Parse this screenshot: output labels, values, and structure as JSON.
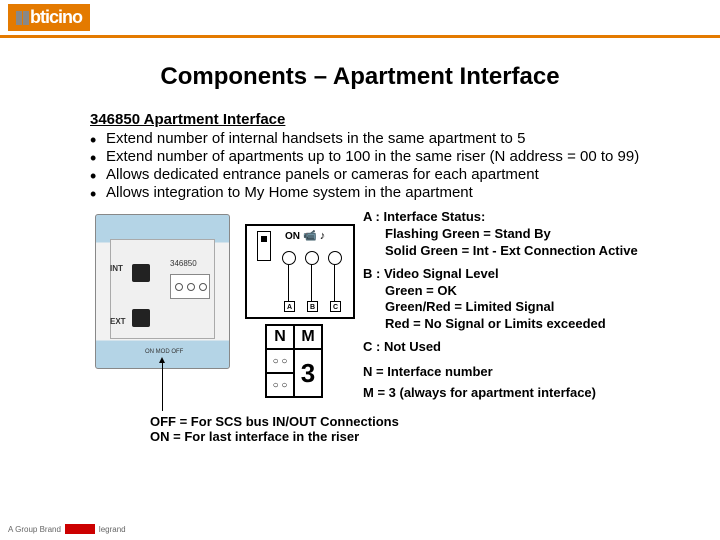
{
  "header": {
    "brand": "bticino"
  },
  "title": "Components – Apartment Interface",
  "subtitle": "346850 Apartment Interface",
  "bullets": [
    "Extend number of internal handsets in the same apartment to 5",
    "Extend number of apartments up to 100 in the same riser (N address = 00 to 99)",
    "Allows dedicated entrance panels or cameras for each apartment",
    "Allows integration to My Home system in the apartment"
  ],
  "device": {
    "model": "346850",
    "int": "INT",
    "ext": "EXT",
    "switch": "ON  MOD  OFF"
  },
  "schematic": {
    "on": "ON",
    "icons": "📹 ♪",
    "a": "A",
    "b": "B",
    "c": "C",
    "n": "N",
    "m": "M",
    "three": "3"
  },
  "legend": {
    "a_label": "A :  Interface Status:",
    "a_line1": "Flashing Green = Stand By",
    "a_line2": "Solid Green       = Int - Ext Connection Active",
    "b_label": "B :  Video Signal Level",
    "b_line1": "Green           = OK",
    "b_line2": "Green/Red = Limited Signal",
    "b_line3": "Red              = No Signal or Limits exceeded",
    "c_label": "C :  Not Used",
    "n_label": "N  = Interface number",
    "m_label": "M = 3 (always for apartment interface)"
  },
  "off_on": {
    "off": "OFF = For SCS bus IN/OUT Connections",
    "on": "ON   = For last interface in the riser"
  },
  "footer": {
    "group": "A Group Brand",
    "brand": "legrand"
  }
}
